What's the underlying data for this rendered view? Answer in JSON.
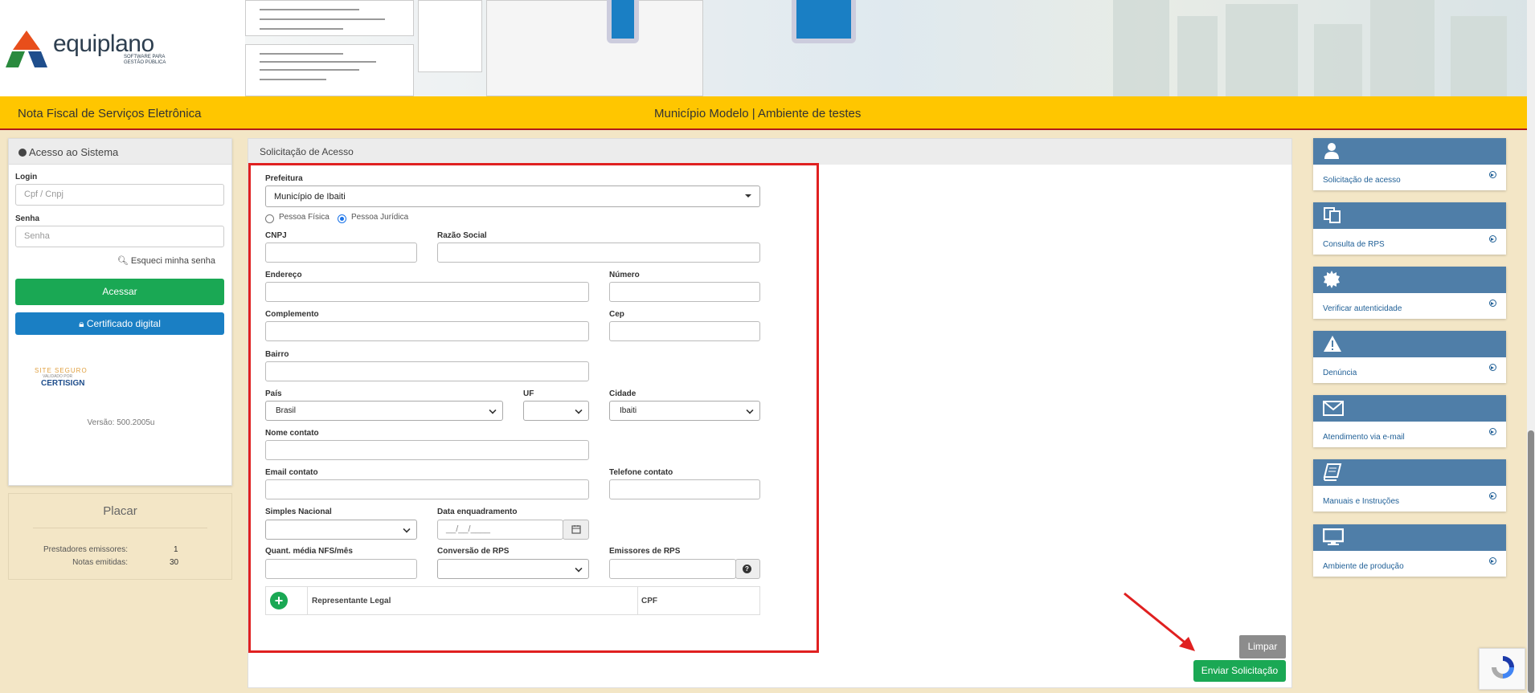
{
  "brand": {
    "name": "equiplano",
    "subtitle_line1": "SOFTWARE PARA",
    "subtitle_line2": "GESTÃO PÚBLICA"
  },
  "navbar": {
    "left": "Nota Fiscal de Serviços Eletrônica",
    "center": "Município Modelo | Ambiente de testes"
  },
  "login_panel": {
    "title": "Acesso ao Sistema",
    "login_label": "Login",
    "login_placeholder": "Cpf / Cnpj",
    "password_label": "Senha",
    "password_placeholder": "Senha",
    "forgot": "Esqueci minha senha",
    "submit": "Acessar",
    "certificate": "Certificado digital",
    "seal_line1": "SITE SEGURO",
    "seal_line2": "VALIDADO POR",
    "seal_line3": "CERTISIGN",
    "version": "Versão: 500.2005u"
  },
  "scoreboard": {
    "title": "Placar",
    "rows": [
      {
        "label": "Prestadores emissores:",
        "value": "1"
      },
      {
        "label": "Notas emitidas:",
        "value": "30"
      }
    ]
  },
  "form": {
    "title": "Solicitação de Acesso",
    "prefeitura_label": "Prefeitura",
    "prefeitura_value": "Município de Ibaiti",
    "radio_pf": "Pessoa Física",
    "radio_pj": "Pessoa Jurídica",
    "selected_person_type": "Pessoa Jurídica",
    "cnpj": "CNPJ",
    "razao": "Razão Social",
    "endereco": "Endereço",
    "numero": "Número",
    "complemento": "Complemento",
    "cep": "Cep",
    "bairro": "Bairro",
    "pais": "País",
    "pais_value": "Brasil",
    "uf": "UF",
    "uf_value": "",
    "cidade": "Cidade",
    "cidade_value": "Ibaiti",
    "nome_contato": "Nome contato",
    "email_contato": "Email contato",
    "telefone_contato": "Telefone contato",
    "simples": "Simples Nacional",
    "simples_value": "",
    "data_enq": "Data enquadramento",
    "data_enq_placeholder": "__/__/____",
    "quant": "Quant. média NFS/mês",
    "conversao": "Conversão de RPS",
    "conversao_value": "",
    "emissores": "Emissores de RPS",
    "rep_col1": "Representante Legal",
    "rep_col2": "CPF",
    "clear": "Limpar",
    "send": "Enviar Solicitação"
  },
  "sidebar": [
    {
      "label": "Solicitação de acesso",
      "icon": "user-icon"
    },
    {
      "label": "Consulta de RPS",
      "icon": "copy-icon"
    },
    {
      "label": "Verificar autenticidade",
      "icon": "certificate-icon"
    },
    {
      "label": "Denúncia",
      "icon": "warning-icon"
    },
    {
      "label": "Atendimento via e-mail",
      "icon": "envelope-icon"
    },
    {
      "label": "Manuais e Instruções",
      "icon": "book-icon"
    },
    {
      "label": "Ambiente de produção",
      "icon": "monitor-icon"
    }
  ],
  "colors": {
    "nav": "#ffc600",
    "card": "#4f7ea8",
    "green": "#1aa854",
    "blue": "#1a7fc4",
    "highlight": "#e02020"
  }
}
